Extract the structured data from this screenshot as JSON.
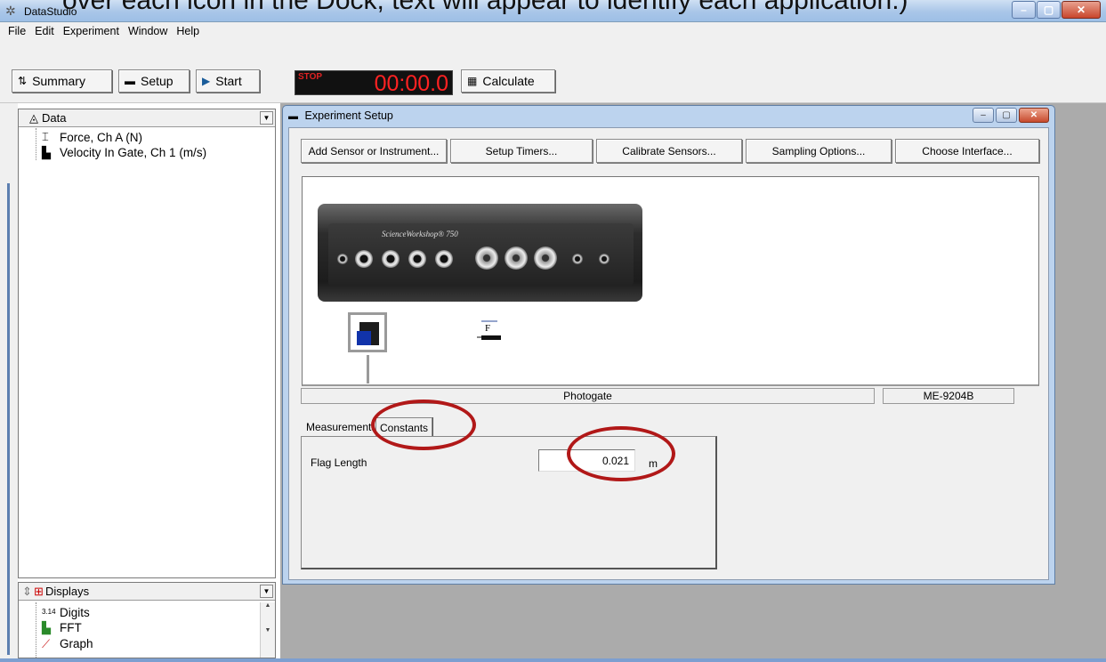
{
  "caption": "over each icon in the Dock, text will appear to identify each application.)",
  "window": {
    "title": "DataStudio"
  },
  "menu": [
    {
      "label": "File"
    },
    {
      "label": "Edit"
    },
    {
      "label": "Experiment"
    },
    {
      "label": "Window"
    },
    {
      "label": "Help"
    }
  ],
  "toolbar": {
    "summary_label": "Summary",
    "setup_label": "Setup",
    "start_label": "Start",
    "stop_label": "STOP",
    "timer_value": "00:00.0",
    "calculate_label": "Calculate"
  },
  "data_panel": {
    "title": "Data",
    "items": [
      {
        "label": "Force, Ch A (N)",
        "icon": "force-sensor-icon"
      },
      {
        "label": "Velocity In Gate, Ch 1 (m/s)",
        "icon": "photogate-icon"
      }
    ]
  },
  "displays_panel": {
    "title": "Displays",
    "items": [
      {
        "label": "Digits",
        "icon": "digits-icon",
        "icon_glyph": "3.14"
      },
      {
        "label": "FFT",
        "icon": "fft-icon"
      },
      {
        "label": "Graph",
        "icon": "graph-icon"
      }
    ]
  },
  "experiment_setup": {
    "title": "Experiment Setup",
    "buttons": [
      {
        "label": "Add Sensor or Instrument..."
      },
      {
        "label": "Setup Timers..."
      },
      {
        "label": "Calibrate Sensors..."
      },
      {
        "label": "Sampling Options..."
      },
      {
        "label": "Choose Interface..."
      }
    ],
    "device": {
      "brand": "ScienceWorkshop® 750"
    },
    "sensor_name": "Photogate",
    "sensor_model": "ME-9204B",
    "tabs": [
      {
        "label": "Measurements",
        "active": false
      },
      {
        "label": "Constants",
        "active": true
      }
    ],
    "constants": {
      "flag_length_label": "Flag Length",
      "flag_length_value": "0.021",
      "flag_length_unit": "m"
    }
  },
  "colors": {
    "annotation": "#b11818",
    "timer_text": "#ff2222",
    "titlebar": "#a9c6e8"
  }
}
